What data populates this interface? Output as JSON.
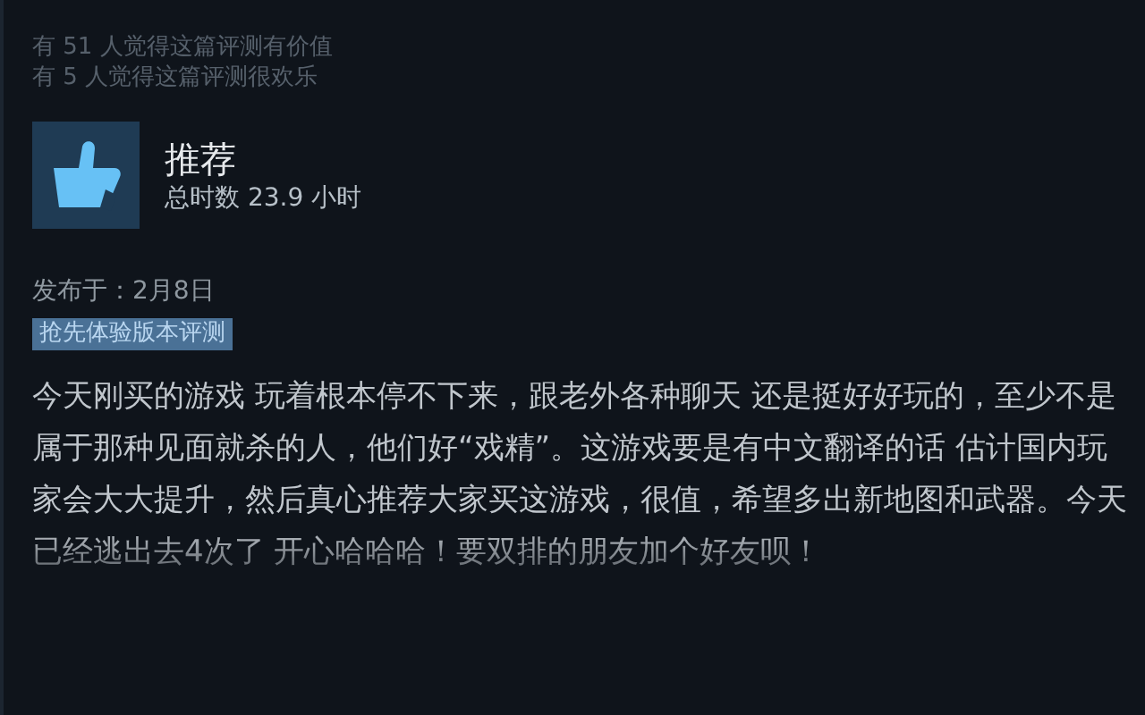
{
  "helpful": [
    "有 51 人觉得这篇评测有价值",
    "有 5 人觉得这篇评测很欢乐"
  ],
  "verdict": {
    "kind": "recommended",
    "title": "推荐",
    "playtime": "总时数 23.9 小时"
  },
  "posted": "发布于：2月8日",
  "badge": "抢先体验版本评测",
  "review_text": "今天刚买的游戏 玩着根本停不下来，跟老外各种聊天 还是挺好好玩的，至少不是属于那种见面就杀的人，他们好“戏精”。这游戏要是有中文翻译的话 估计国内玩家会大大提升，然后真心推荐大家买这游戏，很值，希望多出新地图和武器。今天已经逃出去4次了 开心哈哈哈！要双排的朋友加个好友呗！"
}
